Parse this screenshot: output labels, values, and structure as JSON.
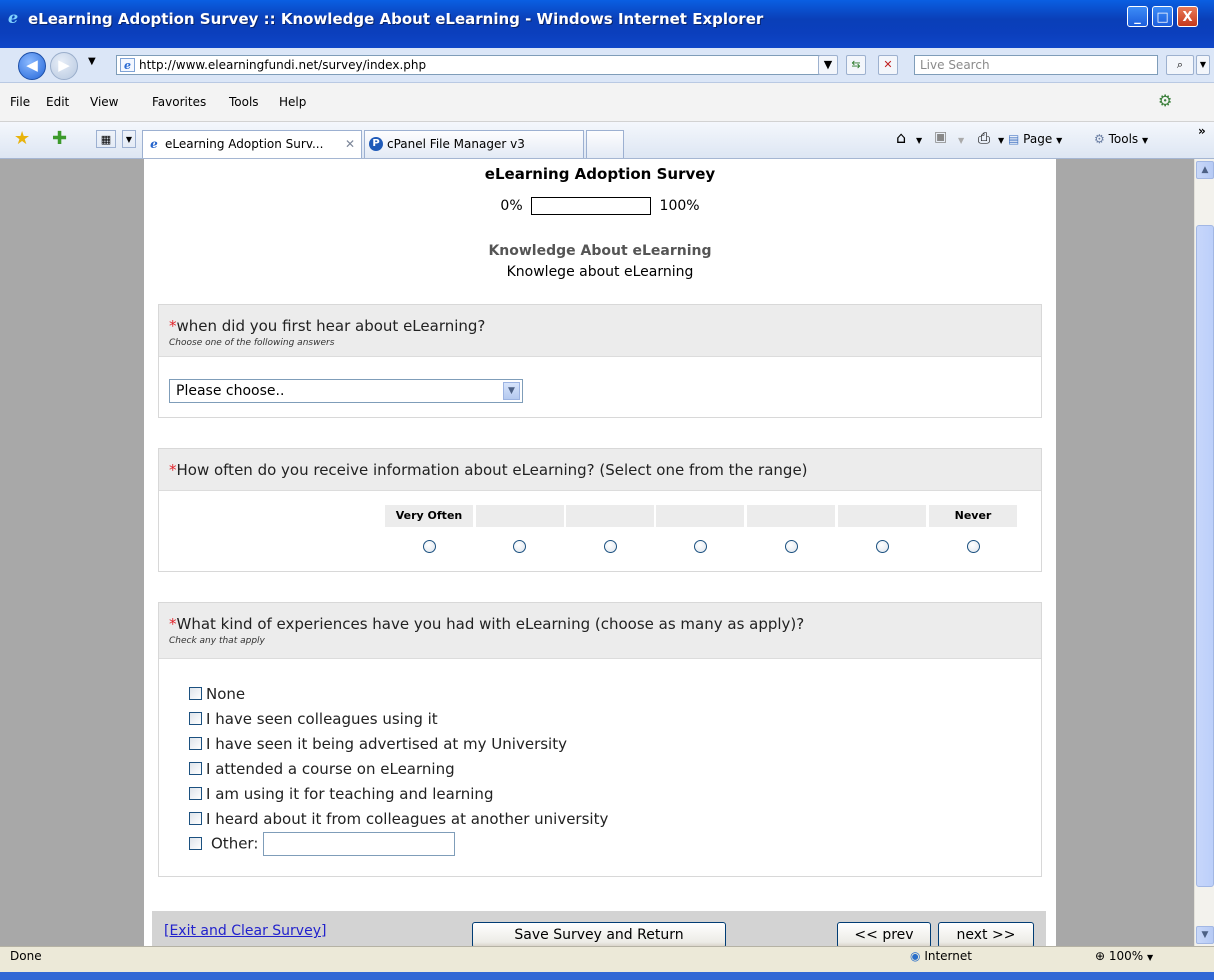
{
  "window": {
    "title": "eLearning Adoption Survey :: Knowledge About eLearning - Windows Internet Explorer",
    "minimize": "_",
    "maximize": "□",
    "close": "X"
  },
  "address": {
    "url": "http://www.elearningfundi.net/survey/index.php",
    "search_placeholder": "Live Search"
  },
  "menu": [
    "File",
    "Edit",
    "View",
    "Favorites",
    "Tools",
    "Help"
  ],
  "tabs": [
    {
      "label": "eLearning Adoption Surv...",
      "active": true
    },
    {
      "label": "cPanel File Manager v3",
      "active": false
    }
  ],
  "commands": {
    "page": "Page",
    "tools": "Tools"
  },
  "survey": {
    "title": "eLearning Adoption Survey",
    "progress_start": "0%",
    "progress_end": "100%",
    "progress_value": 0,
    "group_title": "Knowledge About eLearning",
    "group_description": "Knowlege about eLearning"
  },
  "q1": {
    "required_mark": "*",
    "text": "when did you first hear about eLearning?",
    "help": "Choose one of the following answers",
    "select_value": "Please choose.."
  },
  "q2": {
    "required_mark": "*",
    "text": "How often do you receive information about eLearning? (Select one from the range)",
    "scale_left": "Very Often",
    "scale_right": "Never",
    "scale_points": 7
  },
  "q3": {
    "required_mark": "*",
    "text": "What kind of experiences have you had with eLearning (choose as many as apply)?",
    "help": "Check any that apply",
    "options": [
      "None",
      "I have seen colleagues using it",
      "I have seen it being advertised at my University",
      "I attended a course on eLearning",
      "I am using it for teaching and learning",
      "I heard about it from colleagues at another university"
    ],
    "other_label": "Other:"
  },
  "footer": {
    "exit_link": "[Exit and Clear Survey]",
    "save_button": "Save Survey and Return",
    "prev_button": "<< prev",
    "next_button": "next >>"
  },
  "status": {
    "text": "Done",
    "zone": "Internet",
    "zoom": "100%"
  }
}
